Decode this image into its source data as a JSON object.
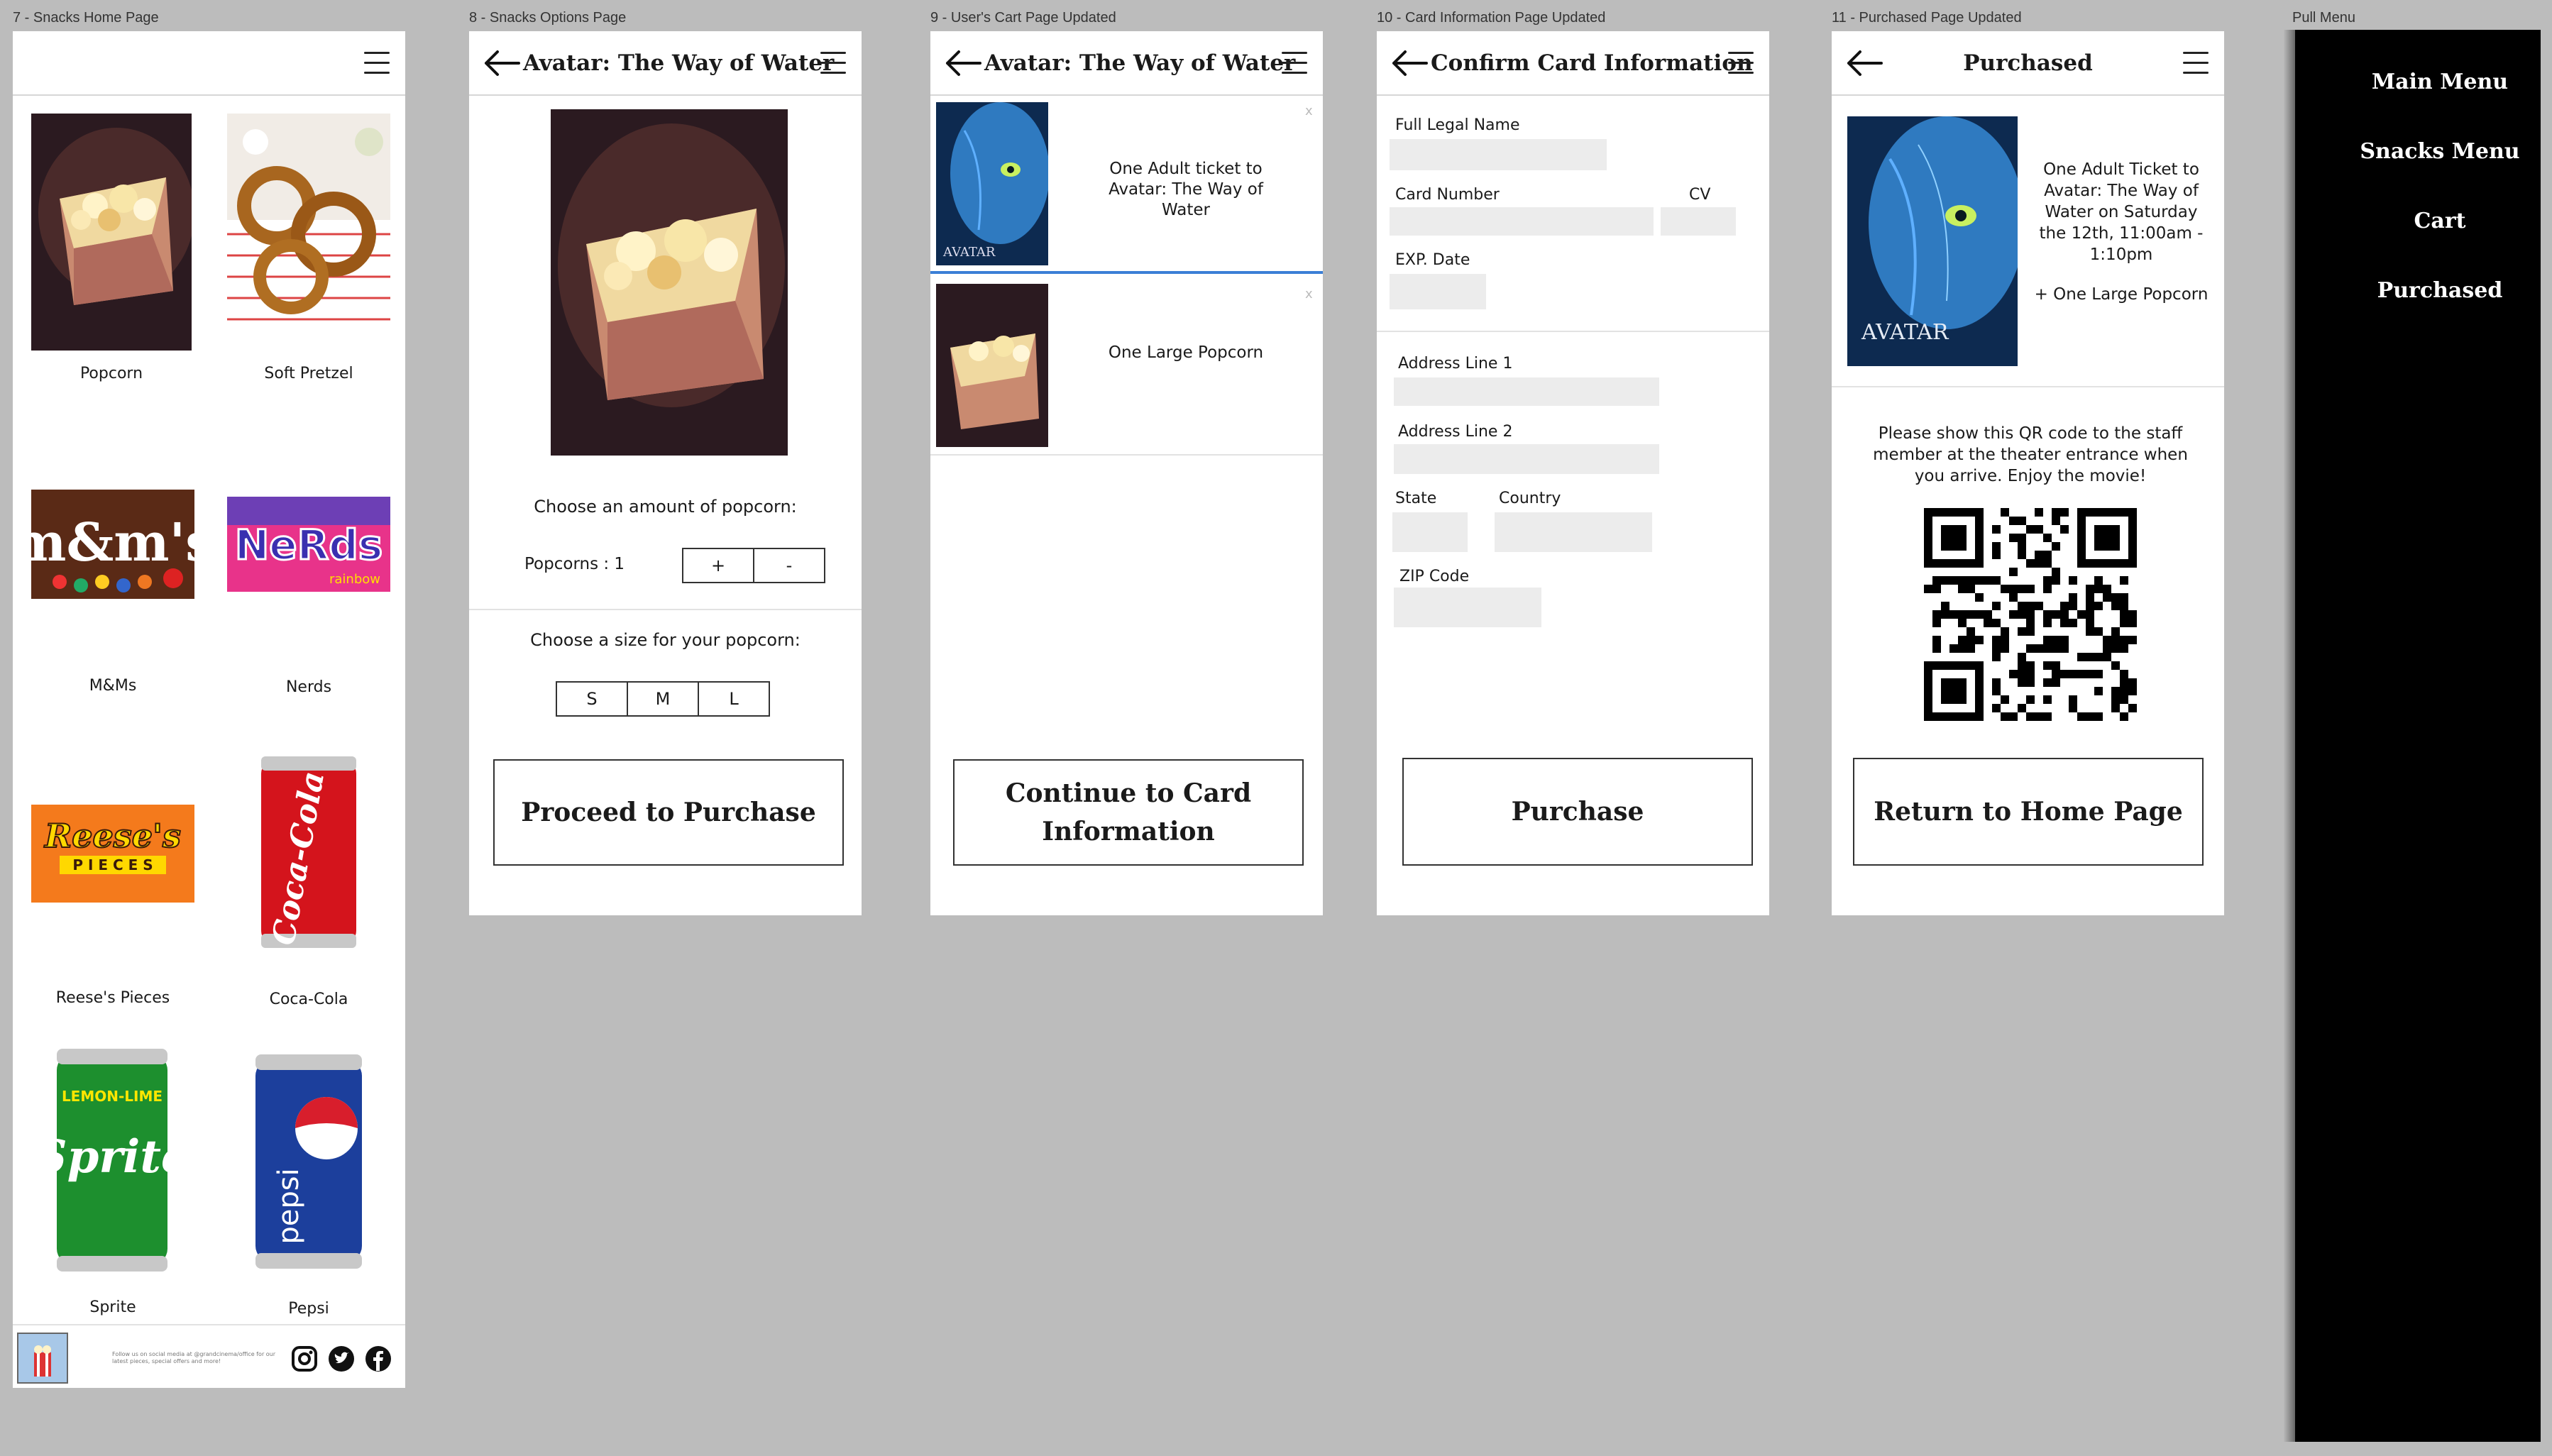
{
  "frame_labels": [
    "7 - Snacks Home Page",
    "8 - Snacks Options Page",
    "9 - User's Cart Page Updated",
    "10 - Card Information Page Updated",
    "11 - Purchased Page Updated",
    "Pull Menu"
  ],
  "home": {
    "snacks": [
      "Popcorn",
      "Soft Pretzel",
      "M&Ms",
      "Nerds",
      "Reese's Pieces",
      "Coca-Cola",
      "Sprite",
      "Pepsi"
    ],
    "footer_text": "Follow us on social media at @grandcinema/office for our latest pieces, special offers and more!"
  },
  "options": {
    "title": "Avatar: The Way of Water",
    "amount_prompt": "Choose an amount of popcorn:",
    "count_label": "Popcorns : 1",
    "plus": "+",
    "minus": "-",
    "size_prompt": "Choose a size for your popcorn:",
    "sizes": [
      "S",
      "M",
      "L"
    ],
    "proceed": "Proceed to Purchase"
  },
  "cart": {
    "title": "Avatar: The Way of Water",
    "items": [
      "One Adult ticket to Avatar: The Way of Water",
      "One Large Popcorn"
    ],
    "remove": "x",
    "poster_text": "AVATAR",
    "continue": "Continue to Card Information"
  },
  "card": {
    "title": "Confirm Card Information",
    "labels": {
      "name": "Full Legal Name",
      "number": "Card Number",
      "cv": "CV",
      "exp": "EXP. Date",
      "addr1": "Address Line 1",
      "addr2": "Address Line 2",
      "state": "State",
      "country": "Country",
      "zip": "ZIP Code"
    },
    "purchase": "Purchase"
  },
  "purchased": {
    "title": "Purchased",
    "ticket": "One Adult Ticket to Avatar: The Way of Water on Saturday the 12th, 11:00am - 1:10pm",
    "addon": "+ One Large Popcorn",
    "poster_text": "AVATAR",
    "qr_note": "Please show this QR code to the staff member at the theater entrance when you arrive. Enjoy the movie!",
    "return": "Return to Home Page"
  },
  "pull_menu": {
    "items": [
      "Main Menu",
      "Snacks Menu",
      "Cart",
      "Purchased"
    ]
  },
  "colors": {
    "canvas": "#bcbcbc",
    "menu_bg": "#000000",
    "cart_divider": "#3b7fd6"
  }
}
